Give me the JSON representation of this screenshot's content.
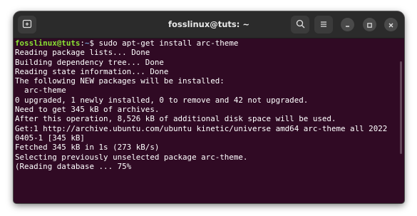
{
  "window": {
    "title": "fosslinux@tuts: ~"
  },
  "titlebar": {
    "icons": {
      "new_tab": "new-tab-icon",
      "search": "search-icon",
      "menu": "hamburger-menu-icon",
      "minimize": "minimize-icon",
      "maximize": "maximize-icon",
      "close": "close-icon"
    }
  },
  "colors": {
    "terminal_bg": "#300a24",
    "titlebar_bg": "#2b2b2b",
    "prompt_user": "#8ae234",
    "prompt_path": "#729fcf",
    "text": "#ffffff"
  },
  "terminal": {
    "prompt": {
      "user_host": "fosslinux@tuts",
      "separator": ":",
      "path": "~",
      "symbol": "$",
      "command": " sudo apt-get install arc-theme"
    },
    "output": [
      "Reading package lists... Done",
      "Building dependency tree... Done",
      "Reading state information... Done",
      "The following NEW packages will be installed:",
      "  arc-theme",
      "0 upgraded, 1 newly installed, 0 to remove and 42 not upgraded.",
      "Need to get 345 kB of archives.",
      "After this operation, 8,526 kB of additional disk space will be used.",
      "Get:1 http://archive.ubuntu.com/ubuntu kinetic/universe amd64 arc-theme all 2022",
      "0405-1 [345 kB]",
      "Fetched 345 kB in 1s (273 kB/s)",
      "Selecting previously unselected package arc-theme.",
      "(Reading database ... 75%"
    ]
  }
}
